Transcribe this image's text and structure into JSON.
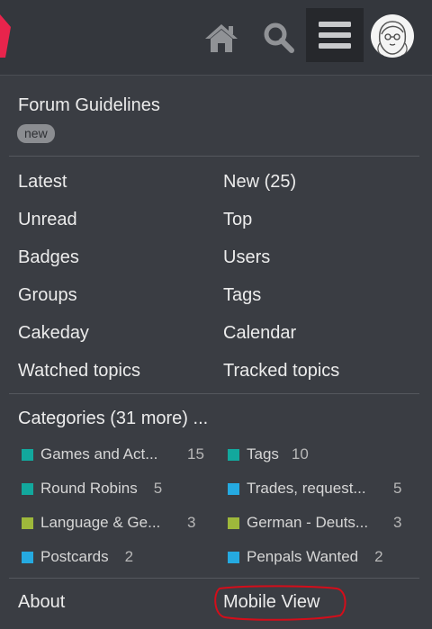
{
  "colors": {
    "background": "#34373d",
    "panel": "#3a3d43",
    "menu_active": "#26282c",
    "logo_accent": "#e8244c",
    "annotation_red": "#d40d1a"
  },
  "header": {
    "home_icon": "home-icon",
    "search_icon": "search-icon",
    "menu_icon": "hamburger-menu-icon",
    "avatar_icon": "user-avatar"
  },
  "menu": {
    "guidelines": "Forum Guidelines",
    "guidelines_badge": "new",
    "links_left": [
      "Latest",
      "Unread",
      "Badges",
      "Groups",
      "Cakeday",
      "Watched topics"
    ],
    "links_right": [
      "New (25)",
      "Top",
      "Users",
      "Tags",
      "Calendar",
      "Tracked topics"
    ],
    "categories_header": "Categories (31 more) ...",
    "categories": [
      {
        "name": "Games and Act...",
        "count": "15",
        "color": "#12a89d"
      },
      {
        "name": "Tags",
        "count": "10",
        "color": "#12a89d"
      },
      {
        "name": "Round Robins",
        "count": "5",
        "color": "#12a89d"
      },
      {
        "name": "Trades, request...",
        "count": "5",
        "color": "#25aae1"
      },
      {
        "name": "Language & Ge...",
        "count": "3",
        "color": "#9eb83b"
      },
      {
        "name": "German - Deuts...",
        "count": "3",
        "color": "#9eb83b"
      },
      {
        "name": "Postcards",
        "count": "2",
        "color": "#25aae1"
      },
      {
        "name": "Penpals Wanted",
        "count": "2",
        "color": "#25aae1"
      }
    ],
    "about": "About",
    "mobile_view": "Mobile View"
  }
}
